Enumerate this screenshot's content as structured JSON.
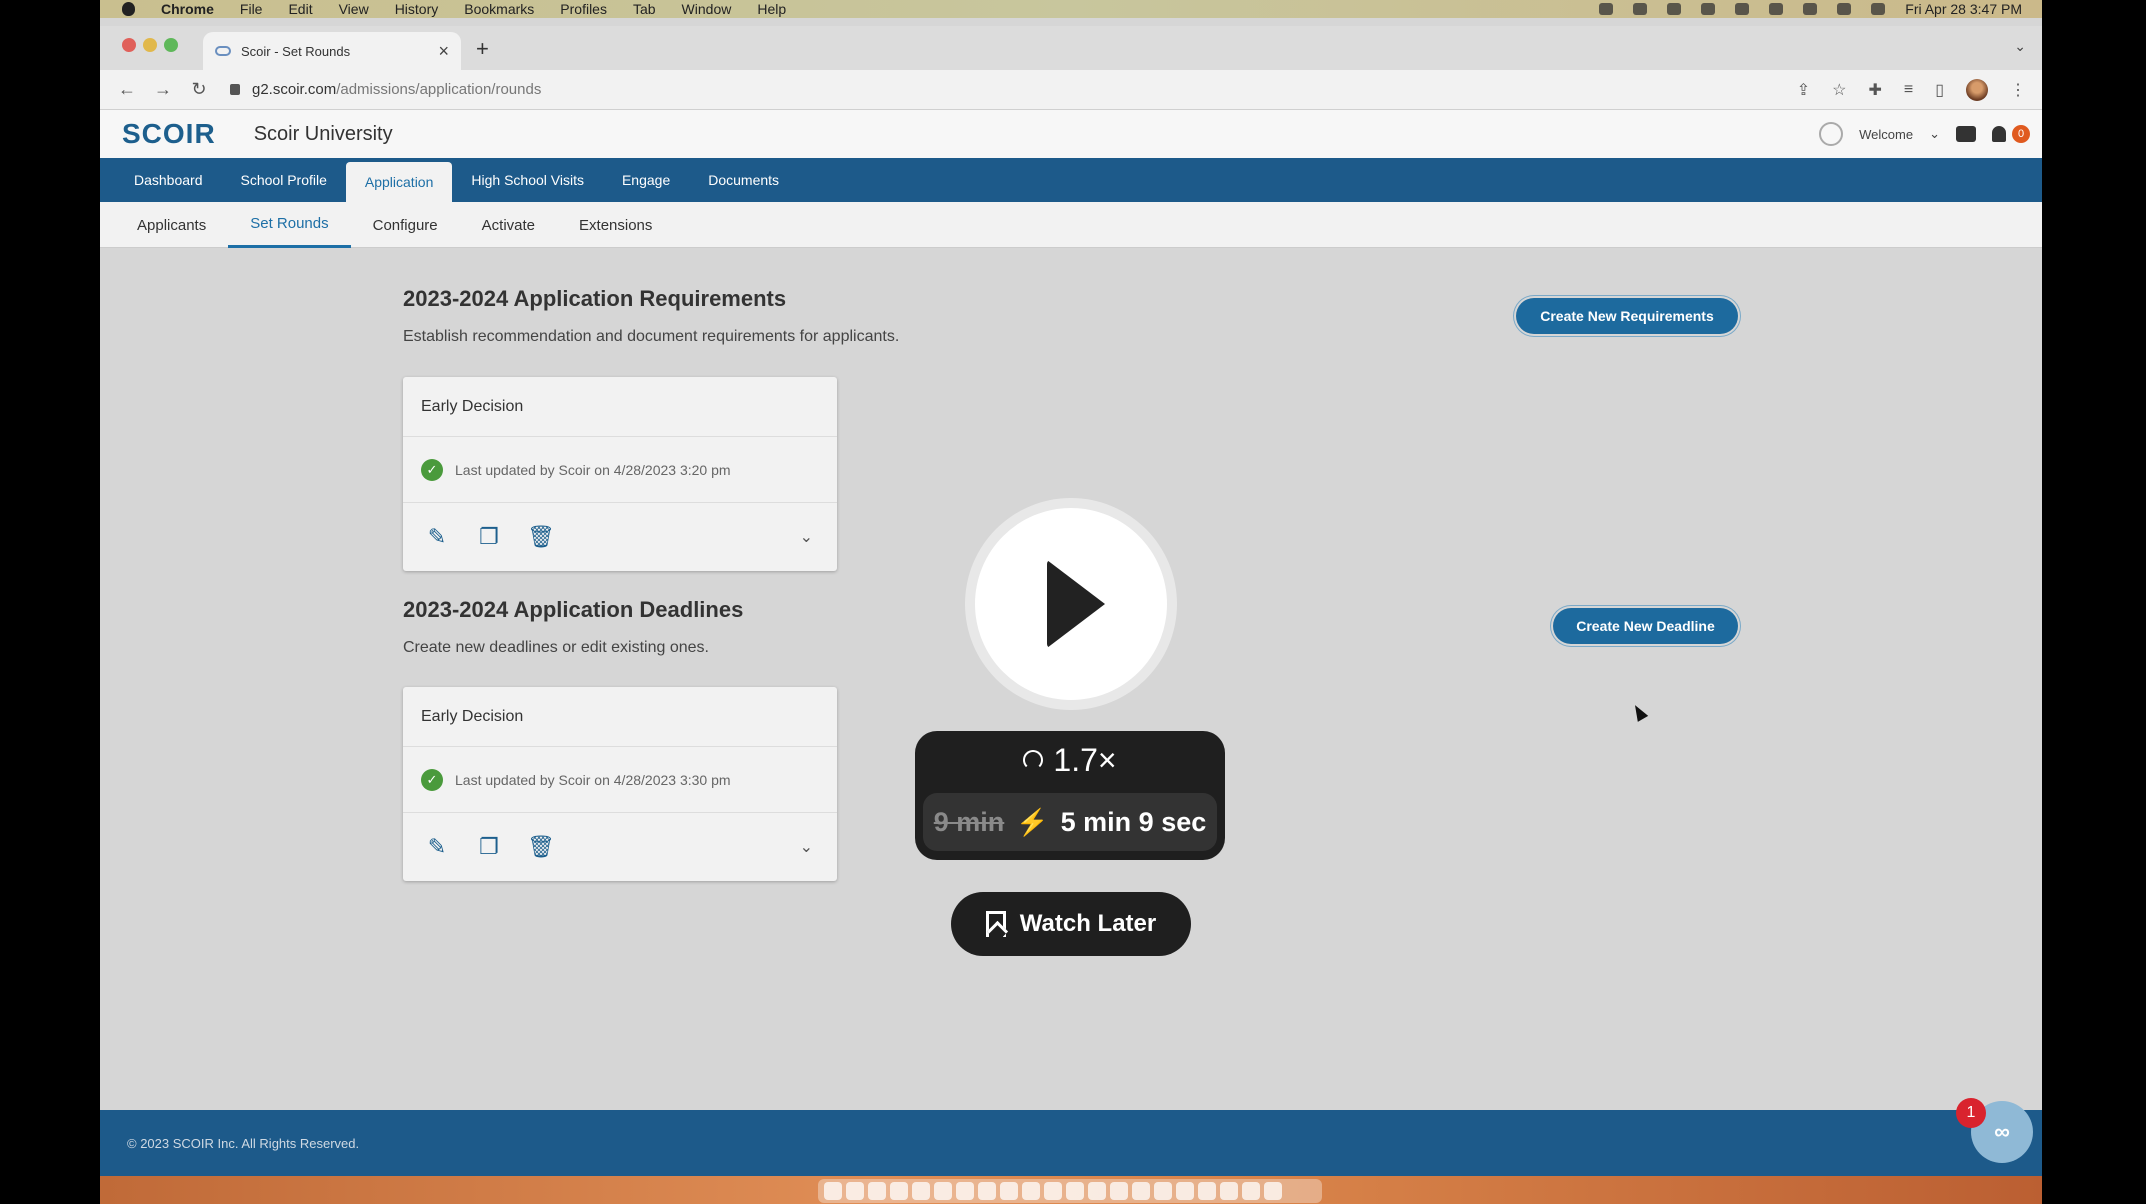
{
  "mac_menu": {
    "app": "Chrome",
    "items": [
      "File",
      "Edit",
      "View",
      "History",
      "Bookmarks",
      "Profiles",
      "Tab",
      "Window",
      "Help"
    ],
    "clock": "Fri Apr 28  3:47 PM"
  },
  "browser": {
    "tab_title": "Scoir - Set Rounds",
    "new_tab": "+",
    "close": "×",
    "url_host": "g2.scoir.com",
    "url_path": "/admissions/application/rounds"
  },
  "header": {
    "logo": "SCOIR",
    "university": "Scoir University",
    "welcome": "Welcome",
    "notification_count": "0"
  },
  "primary_nav": [
    "Dashboard",
    "School Profile",
    "Application",
    "High School Visits",
    "Engage",
    "Documents"
  ],
  "primary_nav_active": "Application",
  "sub_nav": [
    "Applicants",
    "Set Rounds",
    "Configure",
    "Activate",
    "Extensions"
  ],
  "sub_nav_active": "Set Rounds",
  "requirements": {
    "title": "2023-2024 Application Requirements",
    "description": "Establish recommendation and document requirements for applicants.",
    "button": "Create New Requirements",
    "card": {
      "name": "Early Decision",
      "updated": "Last updated by Scoir on 4/28/2023 3:20 pm"
    }
  },
  "deadlines": {
    "title": "2023-2024 Application Deadlines",
    "description": "Create new deadlines or edit existing ones.",
    "button": "Create New Deadline",
    "card": {
      "name": "Early Decision",
      "updated": "Last updated by Scoir on 4/28/2023 3:30 pm"
    }
  },
  "footer": {
    "copyright": "© 2023 SCOIR Inc. All Rights Reserved.",
    "help_badge": "1"
  },
  "video_overlay": {
    "speed": "1.7×",
    "original_time": "9 min",
    "new_time": "5 min 9 sec",
    "watch_later": "Watch Later"
  },
  "colors": {
    "brand_blue": "#1d5a8a",
    "accent_blue": "#1d6fa6",
    "success_green": "#4a9a3c"
  }
}
